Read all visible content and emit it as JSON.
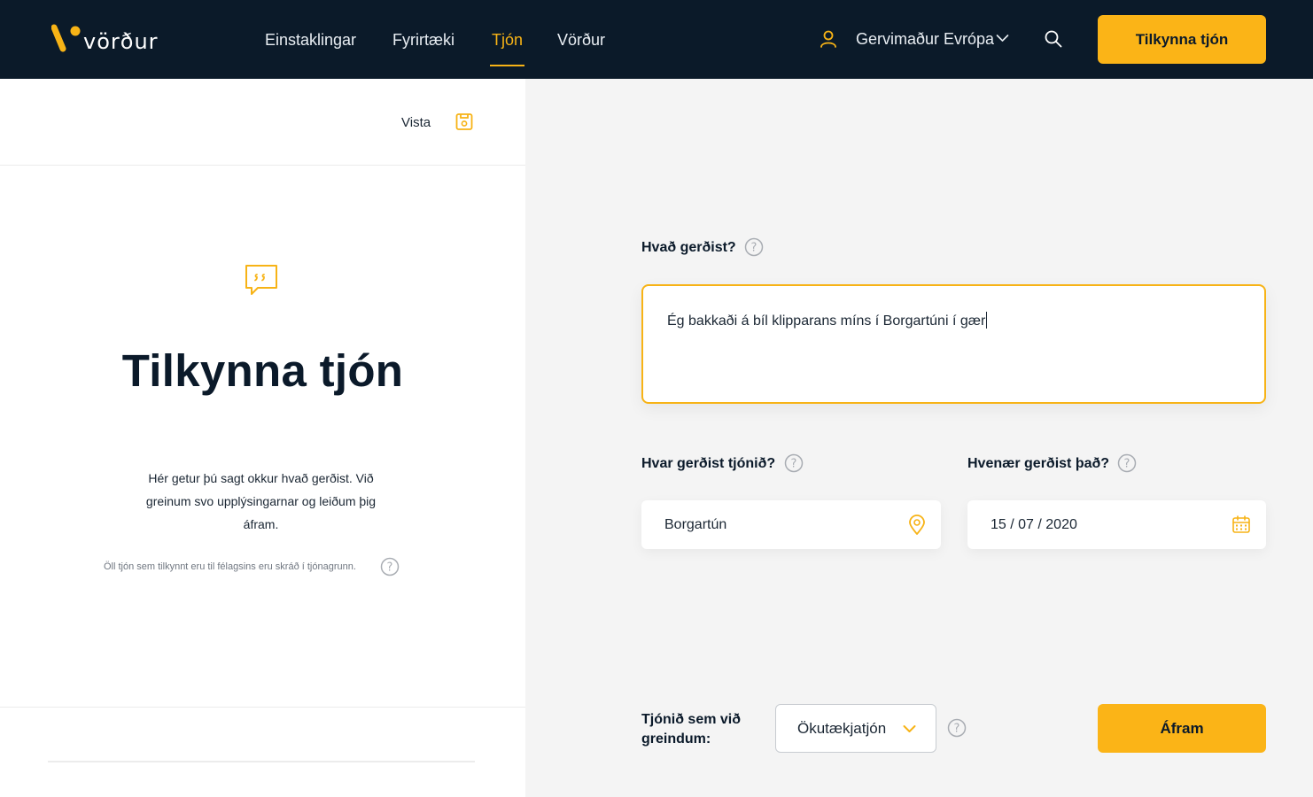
{
  "header": {
    "logo_text": "vörður",
    "nav": [
      "Einstaklingar",
      "Fyrirtæki",
      "Tjón",
      "Vörður"
    ],
    "active_nav": "Tjón",
    "user_name": "Gervimaður Evrópa",
    "report_button": "Tilkynna tjón"
  },
  "left": {
    "save_label": "Vista",
    "title": "Tilkynna tjón",
    "intro": "Hér getur þú sagt okkur hvað gerðist. Við greinum svo upplýsingarnar og leiðum þig áfram.",
    "note": "Öll tjón sem tilkynnt eru til félagsins eru skráð í tjónagrunn."
  },
  "form": {
    "what_label": "Hvað gerðist?",
    "what_value": "Ég bakkaði á bíl klipparans míns í Borgartúni í gær",
    "where_label": "Hvar gerðist tjónið?",
    "where_value": "Borgartún",
    "when_label": "Hvenær gerðist það?",
    "when_value": "15 / 07 / 2020",
    "type_label": "Tjónið sem við greindum:",
    "type_value": "Ökutækjatjón",
    "next_button": "Áfram"
  },
  "colors": {
    "accent": "#f7b316",
    "header_bg": "#0b1a29",
    "panel_bg": "#f4f4f4"
  }
}
